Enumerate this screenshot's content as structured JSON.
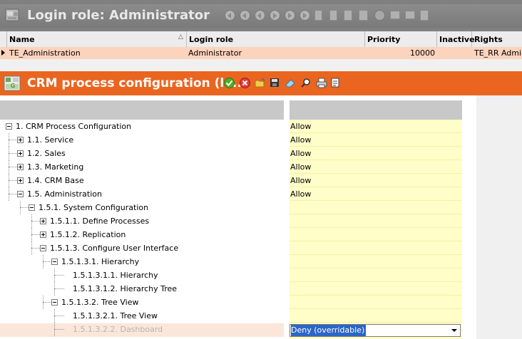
{
  "top_panel": {
    "title": "Login role: Administrator",
    "columns": [
      {
        "key": "name",
        "label": "Name"
      },
      {
        "key": "login_role",
        "label": "Login role"
      },
      {
        "key": "priority",
        "label": "Priority"
      },
      {
        "key": "inactive",
        "label": "Inactive"
      },
      {
        "key": "rights",
        "label": "Rights"
      }
    ],
    "rows": [
      {
        "name": "TE_Administration",
        "login_role": "Administrator",
        "priority": "10000",
        "inactive": "",
        "rights": "TE_RR Admin"
      }
    ],
    "toolbar_icons": [
      "first-record-icon",
      "previous-page-icon",
      "previous-record-icon",
      "next-record-icon",
      "next-page-icon",
      "last-record-icon",
      "new-record-icon",
      "delete-record-icon",
      "save-icon",
      "cancel-icon",
      "print-icon",
      "export-icon"
    ]
  },
  "crm_panel": {
    "title": "CRM process configuration (lo...",
    "toolbar_icons": [
      "checkmark-icon",
      "cancel-icon",
      "open-folder-icon",
      "save-icon",
      "eraser-icon",
      "search-icon",
      "print-icon",
      "export-icon"
    ],
    "tree": [
      {
        "label": "1. CRM Process Configuration",
        "value": "Allow",
        "expander": "minus"
      },
      {
        "label": "1.1. Service",
        "value": "Allow",
        "expander": "plus"
      },
      {
        "label": "1.2. Sales",
        "value": "Allow",
        "expander": "plus"
      },
      {
        "label": "1.3. Marketing",
        "value": "Allow",
        "expander": "plus"
      },
      {
        "label": "1.4. CRM Base",
        "value": "Allow",
        "expander": "plus"
      },
      {
        "label": "1.5. Administration",
        "value": "Allow",
        "expander": "minus"
      },
      {
        "label": "1.5.1. System Configuration",
        "value": "",
        "expander": "minus"
      },
      {
        "label": "1.5.1.1. Define Processes",
        "value": "",
        "expander": "plus"
      },
      {
        "label": "1.5.1.2. Replication",
        "value": "",
        "expander": "plus"
      },
      {
        "label": "1.5.1.3. Configure User Interface",
        "value": "",
        "expander": "minus"
      },
      {
        "label": "1.5.1.3.1. Hierarchy",
        "value": "",
        "expander": "minus"
      },
      {
        "label": "1.5.1.3.1.1. Hierarchy",
        "value": "",
        "expander": "none"
      },
      {
        "label": "1.5.1.3.1.2. Hierarchy Tree",
        "value": "",
        "expander": "none"
      },
      {
        "label": "1.5.1.3.2. Tree View",
        "value": "",
        "expander": "minus"
      },
      {
        "label": "1.5.1.3.2.1. Tree View",
        "value": "",
        "expander": "none"
      },
      {
        "label": "1.5.1.3.2.2. Dashboard",
        "value": "Deny (overridable)",
        "expander": "none"
      }
    ]
  }
}
